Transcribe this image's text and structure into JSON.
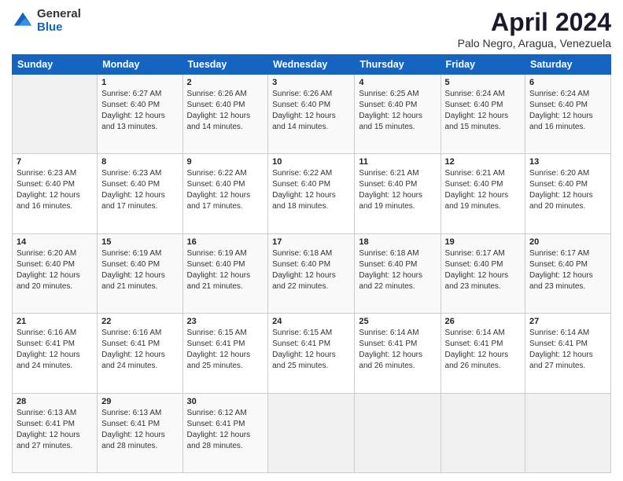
{
  "header": {
    "logo_general": "General",
    "logo_blue": "Blue",
    "title": "April 2024",
    "subtitle": "Palo Negro, Aragua, Venezuela"
  },
  "calendar": {
    "days_of_week": [
      "Sunday",
      "Monday",
      "Tuesday",
      "Wednesday",
      "Thursday",
      "Friday",
      "Saturday"
    ],
    "weeks": [
      [
        {
          "num": "",
          "info": ""
        },
        {
          "num": "1",
          "info": "Sunrise: 6:27 AM\nSunset: 6:40 PM\nDaylight: 12 hours\nand 13 minutes."
        },
        {
          "num": "2",
          "info": "Sunrise: 6:26 AM\nSunset: 6:40 PM\nDaylight: 12 hours\nand 14 minutes."
        },
        {
          "num": "3",
          "info": "Sunrise: 6:26 AM\nSunset: 6:40 PM\nDaylight: 12 hours\nand 14 minutes."
        },
        {
          "num": "4",
          "info": "Sunrise: 6:25 AM\nSunset: 6:40 PM\nDaylight: 12 hours\nand 15 minutes."
        },
        {
          "num": "5",
          "info": "Sunrise: 6:24 AM\nSunset: 6:40 PM\nDaylight: 12 hours\nand 15 minutes."
        },
        {
          "num": "6",
          "info": "Sunrise: 6:24 AM\nSunset: 6:40 PM\nDaylight: 12 hours\nand 16 minutes."
        }
      ],
      [
        {
          "num": "7",
          "info": "Sunrise: 6:23 AM\nSunset: 6:40 PM\nDaylight: 12 hours\nand 16 minutes."
        },
        {
          "num": "8",
          "info": "Sunrise: 6:23 AM\nSunset: 6:40 PM\nDaylight: 12 hours\nand 17 minutes."
        },
        {
          "num": "9",
          "info": "Sunrise: 6:22 AM\nSunset: 6:40 PM\nDaylight: 12 hours\nand 17 minutes."
        },
        {
          "num": "10",
          "info": "Sunrise: 6:22 AM\nSunset: 6:40 PM\nDaylight: 12 hours\nand 18 minutes."
        },
        {
          "num": "11",
          "info": "Sunrise: 6:21 AM\nSunset: 6:40 PM\nDaylight: 12 hours\nand 19 minutes."
        },
        {
          "num": "12",
          "info": "Sunrise: 6:21 AM\nSunset: 6:40 PM\nDaylight: 12 hours\nand 19 minutes."
        },
        {
          "num": "13",
          "info": "Sunrise: 6:20 AM\nSunset: 6:40 PM\nDaylight: 12 hours\nand 20 minutes."
        }
      ],
      [
        {
          "num": "14",
          "info": "Sunrise: 6:20 AM\nSunset: 6:40 PM\nDaylight: 12 hours\nand 20 minutes."
        },
        {
          "num": "15",
          "info": "Sunrise: 6:19 AM\nSunset: 6:40 PM\nDaylight: 12 hours\nand 21 minutes."
        },
        {
          "num": "16",
          "info": "Sunrise: 6:19 AM\nSunset: 6:40 PM\nDaylight: 12 hours\nand 21 minutes."
        },
        {
          "num": "17",
          "info": "Sunrise: 6:18 AM\nSunset: 6:40 PM\nDaylight: 12 hours\nand 22 minutes."
        },
        {
          "num": "18",
          "info": "Sunrise: 6:18 AM\nSunset: 6:40 PM\nDaylight: 12 hours\nand 22 minutes."
        },
        {
          "num": "19",
          "info": "Sunrise: 6:17 AM\nSunset: 6:40 PM\nDaylight: 12 hours\nand 23 minutes."
        },
        {
          "num": "20",
          "info": "Sunrise: 6:17 AM\nSunset: 6:40 PM\nDaylight: 12 hours\nand 23 minutes."
        }
      ],
      [
        {
          "num": "21",
          "info": "Sunrise: 6:16 AM\nSunset: 6:41 PM\nDaylight: 12 hours\nand 24 minutes."
        },
        {
          "num": "22",
          "info": "Sunrise: 6:16 AM\nSunset: 6:41 PM\nDaylight: 12 hours\nand 24 minutes."
        },
        {
          "num": "23",
          "info": "Sunrise: 6:15 AM\nSunset: 6:41 PM\nDaylight: 12 hours\nand 25 minutes."
        },
        {
          "num": "24",
          "info": "Sunrise: 6:15 AM\nSunset: 6:41 PM\nDaylight: 12 hours\nand 25 minutes."
        },
        {
          "num": "25",
          "info": "Sunrise: 6:14 AM\nSunset: 6:41 PM\nDaylight: 12 hours\nand 26 minutes."
        },
        {
          "num": "26",
          "info": "Sunrise: 6:14 AM\nSunset: 6:41 PM\nDaylight: 12 hours\nand 26 minutes."
        },
        {
          "num": "27",
          "info": "Sunrise: 6:14 AM\nSunset: 6:41 PM\nDaylight: 12 hours\nand 27 minutes."
        }
      ],
      [
        {
          "num": "28",
          "info": "Sunrise: 6:13 AM\nSunset: 6:41 PM\nDaylight: 12 hours\nand 27 minutes."
        },
        {
          "num": "29",
          "info": "Sunrise: 6:13 AM\nSunset: 6:41 PM\nDaylight: 12 hours\nand 28 minutes."
        },
        {
          "num": "30",
          "info": "Sunrise: 6:12 AM\nSunset: 6:41 PM\nDaylight: 12 hours\nand 28 minutes."
        },
        {
          "num": "",
          "info": ""
        },
        {
          "num": "",
          "info": ""
        },
        {
          "num": "",
          "info": ""
        },
        {
          "num": "",
          "info": ""
        }
      ]
    ]
  }
}
